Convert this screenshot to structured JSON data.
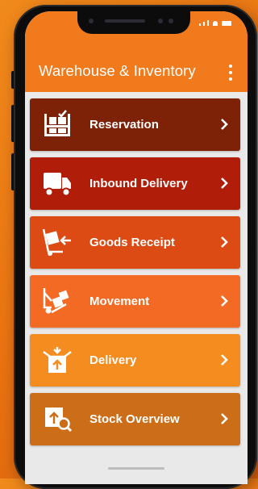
{
  "app": {
    "title": "Warehouse & Inventory"
  },
  "colors": {
    "appbar": "#f07a1c",
    "reservation": "#7d2206",
    "inbound_delivery": "#b01e0a",
    "goods_receipt": "#dc4b14",
    "movement": "#f26a23",
    "delivery": "#f58c20",
    "stock_overview": "#cc6e18"
  },
  "menu": {
    "items": [
      {
        "label": "Reservation",
        "icon": "reservation-icon"
      },
      {
        "label": "Inbound Delivery",
        "icon": "truck-icon"
      },
      {
        "label": "Goods Receipt",
        "icon": "hand-truck-icon"
      },
      {
        "label": "Movement",
        "icon": "forklift-icon"
      },
      {
        "label": "Delivery",
        "icon": "box-upload-icon"
      },
      {
        "label": "Stock Overview",
        "icon": "box-search-icon"
      }
    ]
  }
}
